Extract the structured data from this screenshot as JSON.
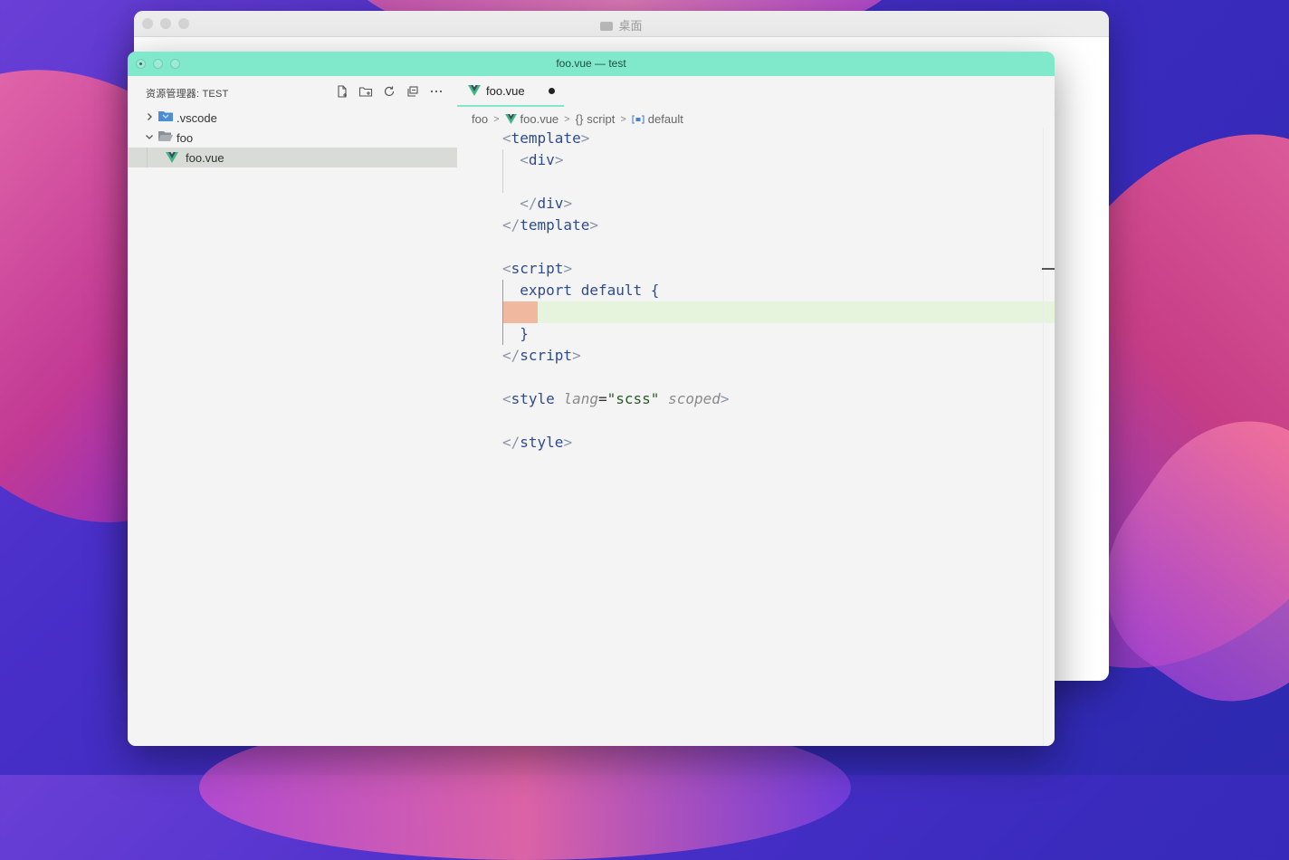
{
  "finder": {
    "title": "桌面"
  },
  "vscode": {
    "window_title": "foo.vue — test",
    "sidebar": {
      "title": "资源管理器: TEST",
      "actions": [
        "new-file-icon",
        "new-folder-icon",
        "refresh-icon",
        "collapse-all-icon",
        "more-icon"
      ],
      "tree": [
        {
          "label": ".vscode",
          "type": "folder",
          "expanded": false
        },
        {
          "label": "foo",
          "type": "folder",
          "expanded": true
        },
        {
          "label": "foo.vue",
          "type": "file",
          "selected": true
        }
      ]
    },
    "editor": {
      "tab": {
        "label": "foo.vue",
        "dirty": true
      },
      "breadcrumb": [
        "foo",
        "foo.vue",
        "script",
        "default"
      ],
      "lines": {
        "l1": "template",
        "l2": "div",
        "l4": "div",
        "l5": "template",
        "l7": "script",
        "l8": "export default {",
        "l10": "}",
        "l11": "script",
        "l13_tag": "style",
        "l13_attr": "lang",
        "l13_val": "\"scss\"",
        "l13_scoped": "scoped",
        "l15": "style"
      }
    },
    "colors": {
      "titlebar": "#80e8cb",
      "tab_accent": "#80e8cb",
      "vue_green": "#41b883",
      "vue_dark": "#34495e"
    }
  }
}
